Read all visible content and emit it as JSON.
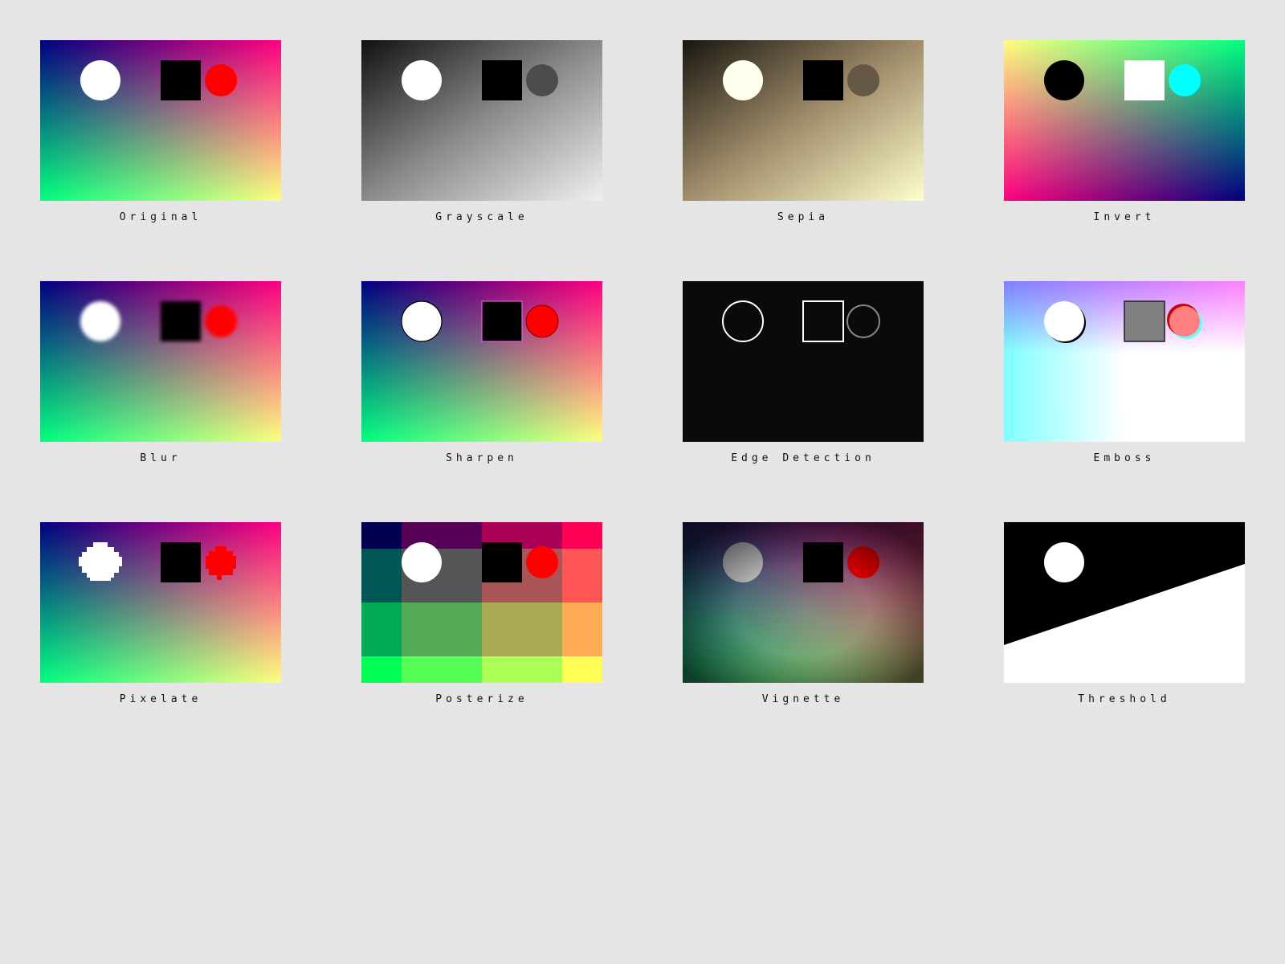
{
  "gallery": {
    "filters": [
      {
        "key": "original",
        "label": "Original"
      },
      {
        "key": "grayscale",
        "label": "Grayscale"
      },
      {
        "key": "sepia",
        "label": "Sepia"
      },
      {
        "key": "invert",
        "label": "Invert"
      },
      {
        "key": "blur",
        "label": "Blur"
      },
      {
        "key": "sharpen",
        "label": "Sharpen"
      },
      {
        "key": "edge",
        "label": "Edge Detection"
      },
      {
        "key": "emboss",
        "label": "Emboss"
      },
      {
        "key": "pixelate",
        "label": "Pixelate"
      },
      {
        "key": "posterize",
        "label": "Posterize"
      },
      {
        "key": "vignette",
        "label": "Vignette"
      },
      {
        "key": "threshold",
        "label": "Threshold"
      }
    ]
  },
  "colors": {
    "background": "#e5e5e5",
    "gradient_top_left": "#000080",
    "gradient_top_right": "#ff0080",
    "gradient_bottom_left": "#00ff80",
    "gradient_bottom_right": "#ffff80",
    "shape_circle_white": "#ffffff",
    "shape_square": "#000000",
    "shape_circle_red": "#ff0000"
  }
}
